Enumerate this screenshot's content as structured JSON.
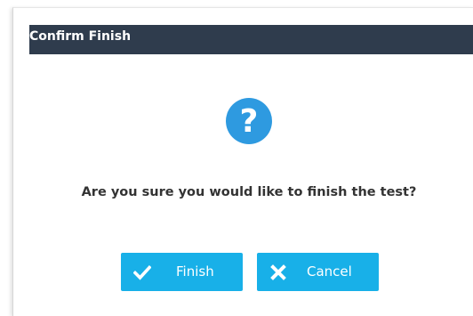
{
  "dialog": {
    "title": "Confirm Finish",
    "icon": "question-circle-icon",
    "message": "Are you sure you would like to finish the test?",
    "buttons": {
      "finish": {
        "label": "Finish",
        "icon": "checkmark-icon"
      },
      "cancel": {
        "label": "Cancel",
        "icon": "x-icon"
      }
    }
  },
  "colors": {
    "header_bg": "#2f3c4d",
    "accent": "#18b0e8",
    "icon_bg": "#2e9ae0",
    "text": "#333333"
  }
}
